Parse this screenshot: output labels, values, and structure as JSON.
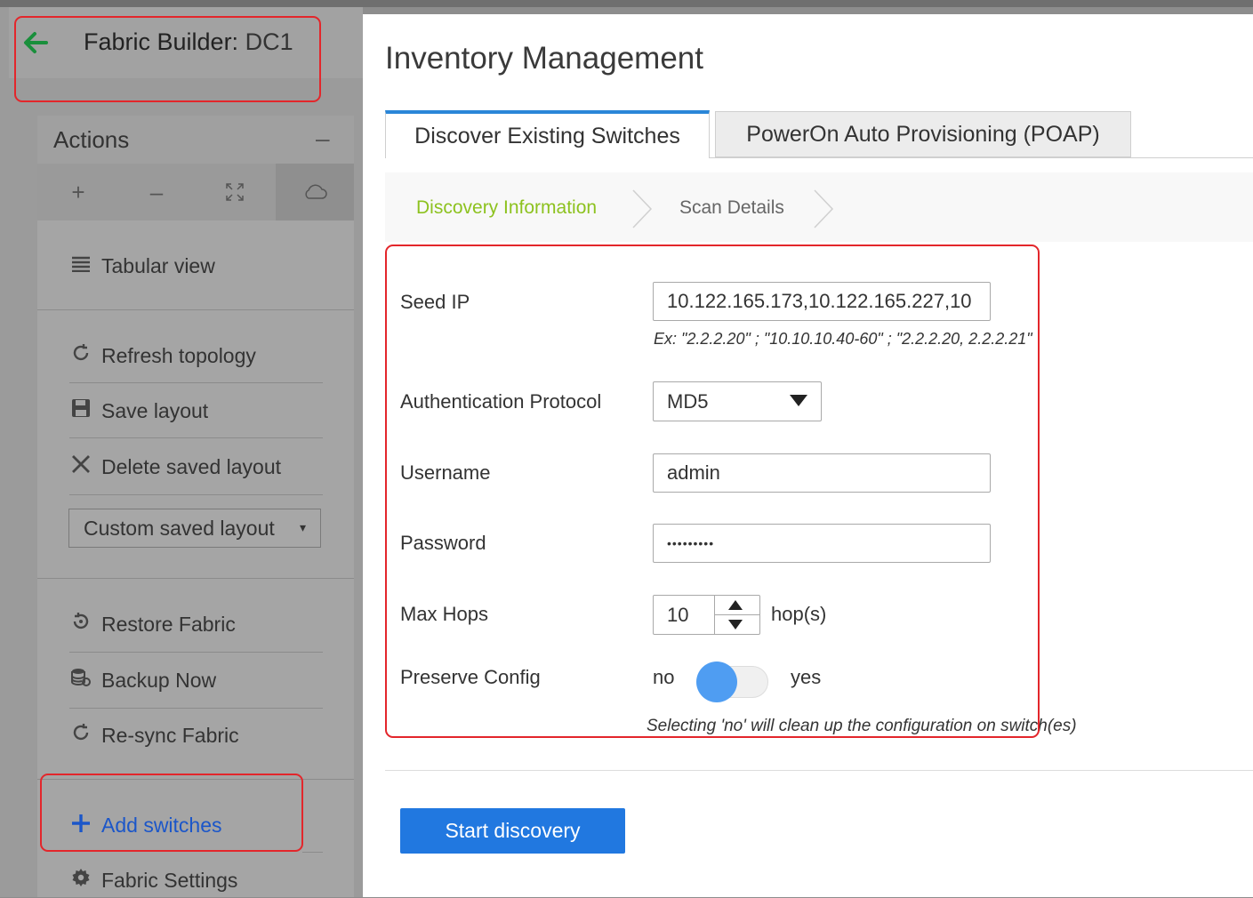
{
  "fabric_header": {
    "label": "Fabric Builder:",
    "name": "DC1"
  },
  "actions": {
    "title": "Actions",
    "collapse_symbol": "–",
    "zoom": {
      "zoom_in": "+",
      "zoom_out": "–",
      "fit": "⤢",
      "cloud": "☁"
    },
    "items": [
      {
        "label": "Tabular view",
        "icon": "list-icon"
      },
      {
        "label": "Refresh topology",
        "icon": "refresh-icon"
      },
      {
        "label": "Save layout",
        "icon": "save-icon"
      },
      {
        "label": "Delete saved layout",
        "icon": "close-icon"
      },
      {
        "label": "Restore Fabric",
        "icon": "restore-icon"
      },
      {
        "label": "Backup Now",
        "icon": "database-icon"
      },
      {
        "label": "Re-sync Fabric",
        "icon": "refresh-icon"
      },
      {
        "label": "Add switches",
        "icon": "plus-icon"
      },
      {
        "label": "Fabric Settings",
        "icon": "gear-icon"
      }
    ],
    "layout_select": {
      "value": "Custom saved layout",
      "caret": "▾"
    }
  },
  "modal": {
    "title": "Inventory Management",
    "tabs": [
      {
        "label": "Discover Existing Switches",
        "active": true
      },
      {
        "label": "PowerOn Auto Provisioning (POAP)",
        "active": false
      }
    ],
    "steps": [
      {
        "label": "Discovery Information",
        "active": true
      },
      {
        "label": "Scan Details",
        "active": false
      }
    ],
    "form": {
      "seed_ip": {
        "label": "Seed IP",
        "value": "10.122.165.173,10.122.165.227,10",
        "hint": "Ex: \"2.2.2.20\" ; \"10.10.10.40-60\" ; \"2.2.2.20, 2.2.2.21\""
      },
      "auth_protocol": {
        "label": "Authentication Protocol",
        "value": "MD5"
      },
      "username": {
        "label": "Username",
        "value": "admin"
      },
      "password": {
        "label": "Password",
        "value": "•••••••••"
      },
      "max_hops": {
        "label": "Max Hops",
        "value": "10",
        "unit": "hop(s)"
      },
      "preserve_config": {
        "label": "Preserve Config",
        "off_label": "no",
        "on_label": "yes",
        "state": "no",
        "hint": "Selecting 'no' will clean up the configuration on switch(es)"
      }
    },
    "start_button": "Start discovery"
  },
  "colors": {
    "accent_blue": "#2178e0",
    "step_active": "#8dc21f",
    "highlight_red": "#e3262b",
    "toggle_knob": "#4f9df2",
    "back_arrow": "#1a8f3c"
  }
}
